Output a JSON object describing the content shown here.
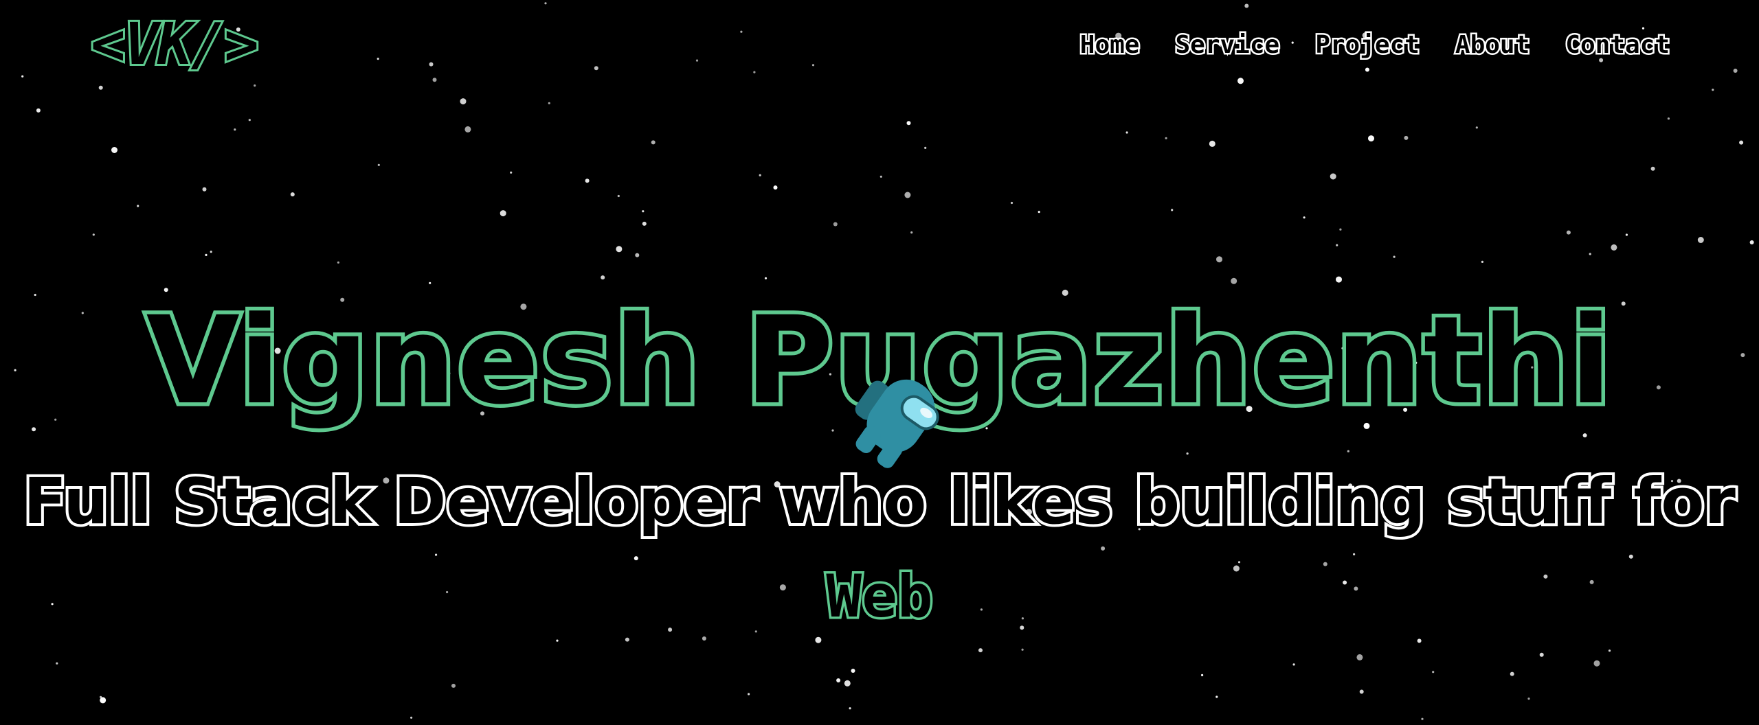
{
  "header": {
    "logo": "<VK/>"
  },
  "nav": {
    "items": [
      {
        "label": "Home"
      },
      {
        "label": "Service"
      },
      {
        "label": "Project"
      },
      {
        "label": "About"
      },
      {
        "label": "Contact"
      }
    ]
  },
  "hero": {
    "name": "Vignesh Pugazhenthi",
    "tagline": "Full Stack Developer who likes building stuff for",
    "role": "Web"
  },
  "decor": {
    "astronaut_icon": "astronaut-icon",
    "background": "starfield"
  },
  "colors": {
    "background": "#000000",
    "accent": "#5ec98f",
    "text_outline": "#ffffff",
    "astronaut": "#2f8fa3"
  }
}
